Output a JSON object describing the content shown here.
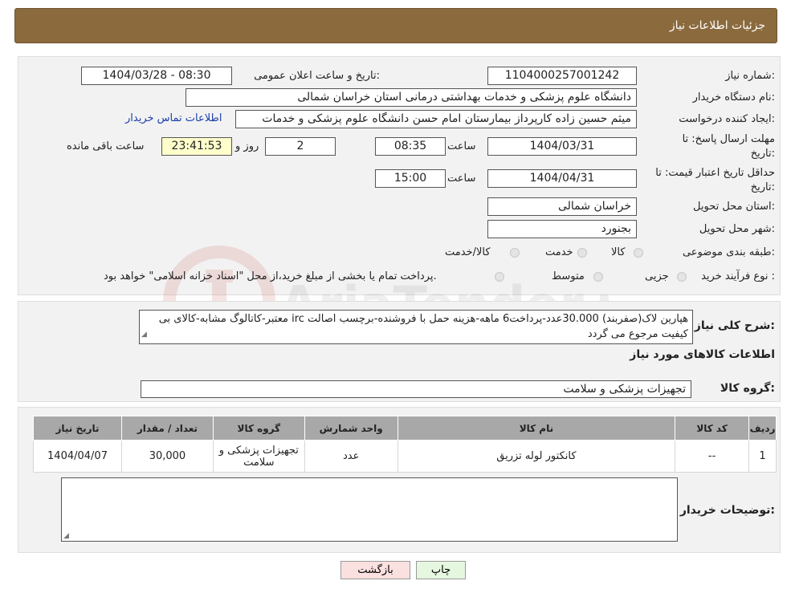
{
  "header": {
    "title": "جزئیات اطلاعات نیاز"
  },
  "fields": {
    "need_number_label": "شماره نیاز:",
    "need_number": "1104000257001242",
    "announce_label": "تاریخ و ساعت اعلان عمومی:",
    "announce_value": "1404/03/28 - 08:30",
    "buyer_org_label": "نام دستگاه خریدار:",
    "buyer_org": "دانشگاه علوم پزشکی و خدمات بهداشتی درمانی استان خراسان شمالی",
    "requester_label": "ایجاد کننده درخواست:",
    "requester": "میثم  حسین زاده  کارپرداز بیمارستان امام حسن دانشگاه علوم پزشکی و خدمات",
    "contact_link": "اطلاعات تماس خریدار",
    "reply_deadline_label_1": "مهلت ارسال پاسخ: تا",
    "reply_deadline_label_2": "تاریخ:",
    "reply_date": "1404/03/31",
    "time_label": "ساعت",
    "reply_time": "08:35",
    "days_value": "2",
    "days_label": "روز و",
    "remaining_time": "23:41:53",
    "remaining_label": "ساعت باقی مانده",
    "validity_label_1": "حداقل تاریخ اعتبار قیمت: تا",
    "validity_label_2": "تاریخ:",
    "validity_date": "1404/04/31",
    "validity_time": "15:00",
    "province_label": "استان محل تحویل:",
    "province": "خراسان شمالی",
    "city_label": "شهر محل تحویل:",
    "city": "بجنورد",
    "category_label": "طبقه بندی موضوعی:",
    "category_options": [
      "کالا",
      "خدمت",
      "کالا/خدمت"
    ],
    "process_label": "نوع فرآیند خرید :",
    "process_options": [
      "جزیی",
      "متوسط"
    ],
    "process_note": "پرداخت تمام یا بخشی از مبلغ خرید،از محل \"اسناد خزانه اسلامی\" خواهد بود."
  },
  "watermark": {
    "text": "AriaTender.neT"
  },
  "description": {
    "label": "شرح کلی نیاز:",
    "text": "هپارین لاک(صفربند) 30.000عدد-پرداخت6 ماهه-هزینه حمل با فروشنده-برچسب اصالت irc معتبر-کاتالوگ مشابه-کالای بی کیفیت مرجوع می گردد",
    "goods_info_title": "اطلاعات کالاهای مورد نیاز",
    "goods_group_label": "گروه کالا:",
    "goods_group": "تجهیزات پزشکی و سلامت"
  },
  "table": {
    "headers": [
      "ردیف",
      "کد کالا",
      "نام کالا",
      "واحد شمارش",
      "گروه کالا",
      "تعداد / مقدار",
      "تاریخ نیاز"
    ],
    "rows": [
      [
        "1",
        "--",
        "کانکتور لوله تزریق",
        "عدد",
        "تجهیزات پزشکی و سلامت",
        "30,000",
        "1404/04/07"
      ]
    ]
  },
  "notes": {
    "label": "توضیحات خریدار:"
  },
  "buttons": {
    "print": "چاپ",
    "back": "بازگشت"
  }
}
